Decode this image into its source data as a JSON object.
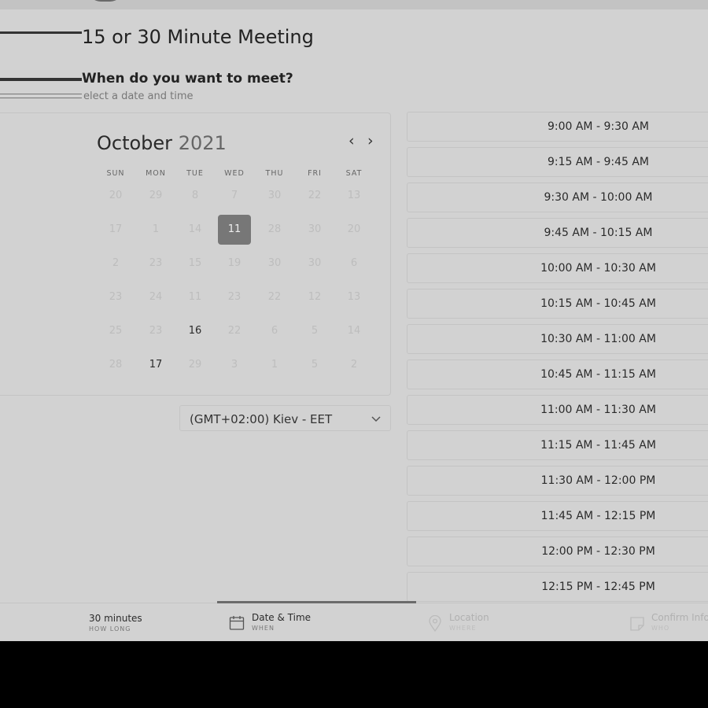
{
  "header": {
    "title": "15 or 30 Minute Meeting",
    "question": "When do you want to meet?",
    "subtitle": "elect a date and time"
  },
  "calendar": {
    "month": "October",
    "year": "2021",
    "weekdays": [
      "SUN",
      "MON",
      "TUE",
      "WED",
      "THU",
      "FRI",
      "SAT"
    ],
    "weeks": [
      [
        "20",
        "29",
        "8",
        "7",
        "30",
        "22",
        "13"
      ],
      [
        "17",
        "1",
        "14",
        "11",
        "28",
        "30",
        "20"
      ],
      [
        "2",
        "23",
        "15",
        "19",
        "30",
        "30",
        "6"
      ],
      [
        "23",
        "24",
        "11",
        "23",
        "22",
        "12",
        "13"
      ],
      [
        "25",
        "23",
        "16",
        "22",
        "6",
        "5",
        "14"
      ],
      [
        "28",
        "17",
        "29",
        "3",
        "1",
        "5",
        "2"
      ]
    ],
    "selected_day": "11",
    "available_days": [
      "16",
      "17"
    ]
  },
  "timezone": {
    "value": "(GMT+02:00) Kiev - EET"
  },
  "time_slots": [
    "9:00 AM - 9:30 AM",
    "9:15 AM - 9:45 AM",
    "9:30 AM - 10:00 AM",
    "9:45 AM - 10:15 AM",
    "10:00 AM - 10:30 AM",
    "10:15 AM - 10:45 AM",
    "10:30 AM - 11:00 AM",
    "10:45 AM - 11:15 AM",
    "11:00 AM - 11:30 AM",
    "11:15 AM - 11:45 AM",
    "11:30 AM - 12:00 PM",
    "11:45 AM - 12:15 PM",
    "12:00 PM - 12:30 PM",
    "12:15 PM - 12:45 PM"
  ],
  "footer": {
    "steps": [
      {
        "label": "30 minutes",
        "sub": "HOW LONG"
      },
      {
        "label": "Date & Time",
        "sub": "WHEN"
      },
      {
        "label": "Location",
        "sub": "WHERE"
      },
      {
        "label": "Confirm Info",
        "sub": "WHO"
      }
    ]
  },
  "icons": {
    "calendar": "calendar-icon",
    "location": "map-pin-icon",
    "confirm": "note-icon",
    "chevron": "chevron-down-icon"
  },
  "colors": {
    "background": "#d2d2d2",
    "selected_day": "#777777",
    "border": "#c4c4c4"
  }
}
